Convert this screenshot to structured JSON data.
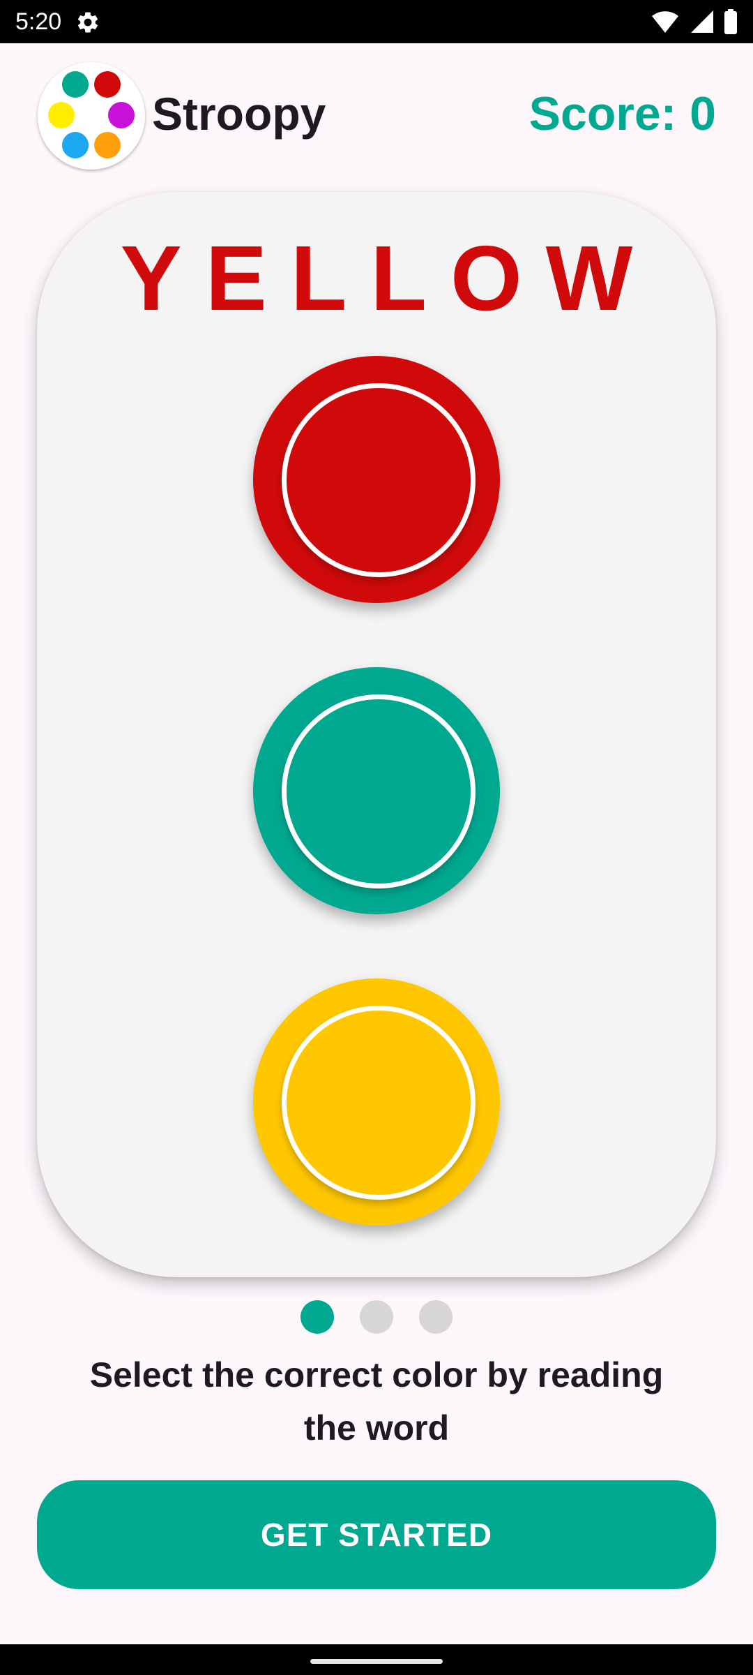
{
  "status_bar": {
    "time": "5:20",
    "icons": [
      "settings-icon",
      "wifi-icon",
      "signal-icon",
      "battery-icon"
    ]
  },
  "header": {
    "app_name": "Stroopy",
    "score_text": "Score: 0",
    "logo_dot_colors": [
      "#00a890",
      "#d00a0a",
      "#ffee00",
      "#c810d8",
      "#1aa8f0",
      "#ff9f0a"
    ]
  },
  "game": {
    "word": "YELLOW",
    "word_color": "#d00a0a",
    "options": [
      {
        "name": "red",
        "color": "#d00a0a"
      },
      {
        "name": "green",
        "color": "#00a890"
      },
      {
        "name": "yellow",
        "color": "#ffc700"
      }
    ]
  },
  "onboarding": {
    "pages": 3,
    "current_page": 1,
    "instruction": "Select the correct color by reading the word",
    "cta_label": "GET STARTED"
  },
  "colors": {
    "accent": "#00a890",
    "background": "#fdf7fc",
    "card": "#f4f4f4",
    "inactive_dot": "#d6d6d6"
  }
}
